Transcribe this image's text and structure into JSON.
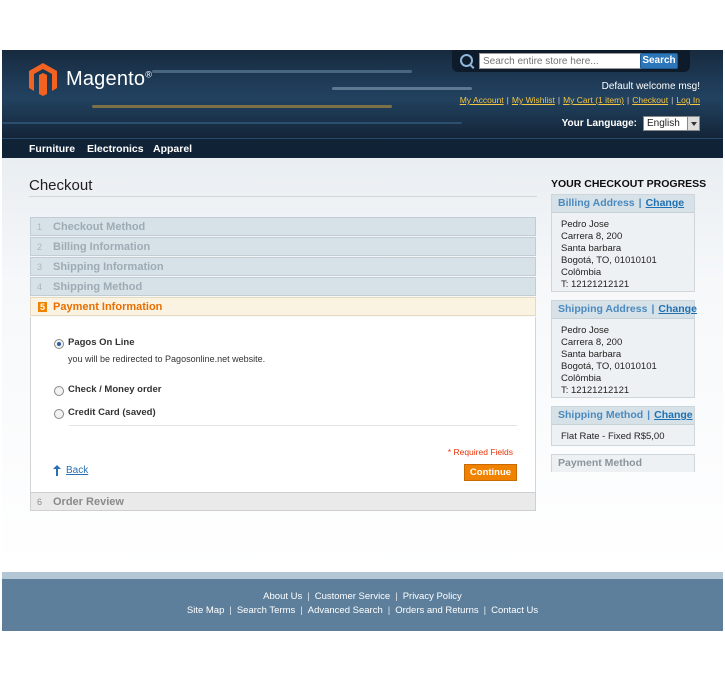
{
  "header": {
    "logo_text": "Magento",
    "logo_mark": "®",
    "search_placeholder": "Search entire store here...",
    "search_button": "Search",
    "welcome": "Default welcome msg!",
    "links": [
      "My Account",
      "My Wishlist",
      "My Cart (1 item)",
      "Checkout",
      "Log In"
    ],
    "language_label": "Your Language:",
    "language_value": "English"
  },
  "nav": [
    "Furniture",
    "Electronics",
    "Apparel"
  ],
  "checkout": {
    "title": "Checkout",
    "steps": [
      {
        "num": "1",
        "label": "Checkout Method"
      },
      {
        "num": "2",
        "label": "Billing Information"
      },
      {
        "num": "3",
        "label": "Shipping Information"
      },
      {
        "num": "4",
        "label": "Shipping Method"
      },
      {
        "num": "5",
        "label": "Payment Information"
      },
      {
        "num": "6",
        "label": "Order Review"
      }
    ],
    "payment": {
      "opt1": "Pagos On Line",
      "opt1_note": "you will be redirected to Pagosonline.net website.",
      "opt2": "Check / Money order",
      "opt3": "Credit Card (saved)",
      "required": "* Required Fields",
      "back": "Back",
      "continue": "Continue"
    }
  },
  "progress": {
    "title": "YOUR CHECKOUT PROGRESS",
    "change": "Change",
    "billing": {
      "title": "Billing Address",
      "lines": [
        "Pedro Jose",
        "Carrera 8, 200",
        "Santa barbara",
        "Bogotá, TO, 01010101",
        "Colômbia",
        "T: 12121212121"
      ]
    },
    "shipping": {
      "title": "Shipping Address",
      "lines": [
        "Pedro Jose",
        "Carrera 8, 200",
        "Santa barbara",
        "Bogotá, TO, 01010101",
        "Colômbia",
        "T: 12121212121"
      ]
    },
    "method": {
      "title": "Shipping Method",
      "value": "Flat Rate - Fixed R$5,00"
    },
    "payment_title": "Payment Method"
  },
  "footer": {
    "row1": [
      "About Us",
      "Customer Service",
      "Privacy Policy"
    ],
    "row2": [
      "Site Map",
      "Search Terms",
      "Advanced Search",
      "Orders and Returns",
      "Contact Us"
    ]
  }
}
